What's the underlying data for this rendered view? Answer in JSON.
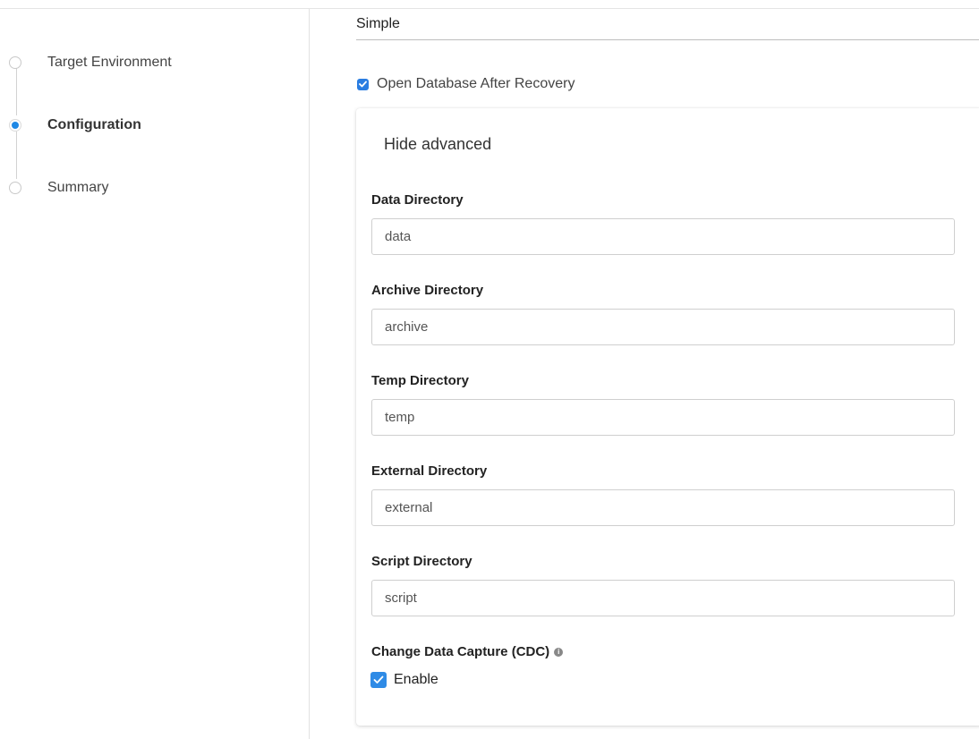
{
  "stepper": {
    "steps": [
      {
        "label": "Target Environment",
        "state": "inactive"
      },
      {
        "label": "Configuration",
        "state": "active"
      },
      {
        "label": "Summary",
        "state": "inactive"
      }
    ]
  },
  "main": {
    "mode_label": "Simple",
    "open_db_label": "Open Database After Recovery",
    "open_db_checked": true,
    "advanced": {
      "toggle_label": "Hide advanced",
      "fields": [
        {
          "label": "Data Directory",
          "value": "data"
        },
        {
          "label": "Archive Directory",
          "value": "archive"
        },
        {
          "label": "Temp Directory",
          "value": "temp"
        },
        {
          "label": "External Directory",
          "value": "external"
        },
        {
          "label": "Script Directory",
          "value": "script"
        }
      ],
      "cdc_label": "Change Data Capture (CDC)",
      "cdc_info_icon": "info-icon",
      "enable_label": "Enable",
      "enable_checked": true
    }
  },
  "colors": {
    "accent": "#1e88e5",
    "checkbox": "#2f8be6",
    "border": "#cfcfcf"
  }
}
